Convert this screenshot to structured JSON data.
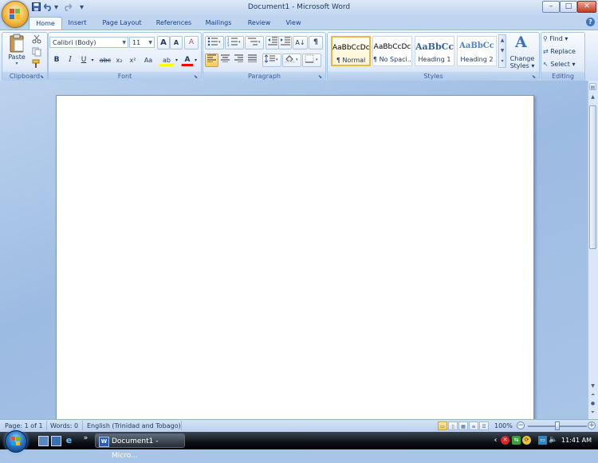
{
  "window": {
    "title": "Document1 - Microsoft Word",
    "controls": {
      "minimize": "–",
      "maximize": "□",
      "close": "✕"
    }
  },
  "quick_access": {
    "save_icon": "save-icon",
    "undo_icon": "undo-icon",
    "redo_icon": "redo-icon",
    "customize_glyph": "▾"
  },
  "ribbon": {
    "tabs": [
      {
        "label": "Home",
        "active": true
      },
      {
        "label": "Insert"
      },
      {
        "label": "Page Layout"
      },
      {
        "label": "References"
      },
      {
        "label": "Mailings"
      },
      {
        "label": "Review"
      },
      {
        "label": "View"
      }
    ],
    "help_glyph": "?",
    "clipboard": {
      "label": "Clipboard",
      "paste_label": "Paste",
      "paste_arrow": "▾"
    },
    "font": {
      "label": "Font",
      "font_name": "Calibri (Body)",
      "font_size": "11",
      "grow_font": "A",
      "shrink_font": "A",
      "clear_format": "A",
      "bold": "B",
      "italic": "I",
      "underline": "U",
      "strikethrough": "abc",
      "subscript": "x₂",
      "superscript": "x²",
      "change_case": "Aa",
      "highlight": "ab",
      "font_color": "A"
    },
    "paragraph": {
      "label": "Paragraph",
      "pilcrow": "¶",
      "sort": "A↓"
    },
    "styles": {
      "label": "Styles",
      "tiles": [
        {
          "sample": "AaBbCcDc",
          "name": "¶ Normal"
        },
        {
          "sample": "AaBbCcDc",
          "name": "¶ No Spaci..."
        },
        {
          "sample": "AaBbCc",
          "name": "Heading 1"
        },
        {
          "sample": "AaBbCc",
          "name": "Heading 2"
        }
      ],
      "change_styles_line1": "Change",
      "change_styles_line2": "Styles ▾"
    },
    "editing": {
      "label": "Editing",
      "find": "Find ▾",
      "replace": "Replace",
      "select": "Select ▾"
    }
  },
  "statusbar": {
    "page": "Page: 1 of 1",
    "words": "Words: 0",
    "language": "English (Trinidad and Tobago)",
    "zoom": "100%",
    "zoom_fraction": 0.5
  },
  "taskbar": {
    "task_label": "Document1 - Micro...",
    "clock": "11:41 AM",
    "overflow_glyph": "»",
    "tray_arrow": "‹"
  },
  "colors": {
    "ribbon_text": "#15428b",
    "highlight_yellow": "#ffff00",
    "font_color_red": "#ff0000"
  }
}
